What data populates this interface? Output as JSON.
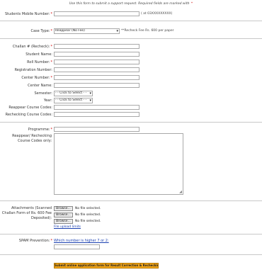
{
  "header": {
    "note": "Use this form to submit a support request. Required fields are marked with",
    "required_mark": "*"
  },
  "mobile": {
    "label": "Students Mobile Number:",
    "hint": "( at 03XXXXXXXXX)"
  },
  "case_type": {
    "label": "Case Type:",
    "selected": "Reappear (No Fee)",
    "note": "**Recheck Fee Rs. 600 per paper"
  },
  "fields": {
    "challan": "Challan # (Recheck):",
    "student_name": "Student Name:",
    "roll_number": "Roll Number:",
    "registration": "Registration Number:",
    "center_number": "Center Number:",
    "center_name": "Center Name:",
    "semester": "Semester:",
    "year": "Year:",
    "reappear_codes": "Reappear Course Codes:",
    "recheck_codes": "Rechecking Course Codes:"
  },
  "semester_select": {
    "selected": "- - Click to Select - -"
  },
  "year_select": {
    "selected": "- - Click to Select - -"
  },
  "programme": {
    "label": "Programme:"
  },
  "subjects": {
    "label": "Reappear/ Rechecking Course Codes only:"
  },
  "attachments": {
    "label": "Attachments (Scanned Challan Form of Rs. 600 Fee Deposited):",
    "browse_label": "Browse...",
    "no_file": "No file selected.",
    "upload_limits": "File upload limits"
  },
  "spam": {
    "label": "SPAM Prevention:",
    "question": "Which number is higher 7 or 2:"
  },
  "submit": {
    "label": "Submit online application form for Result Correction & Rechecking"
  },
  "colors": {
    "required": "#d00000",
    "submit_bg": "#f0a51a",
    "link": "#1a3fb0"
  }
}
